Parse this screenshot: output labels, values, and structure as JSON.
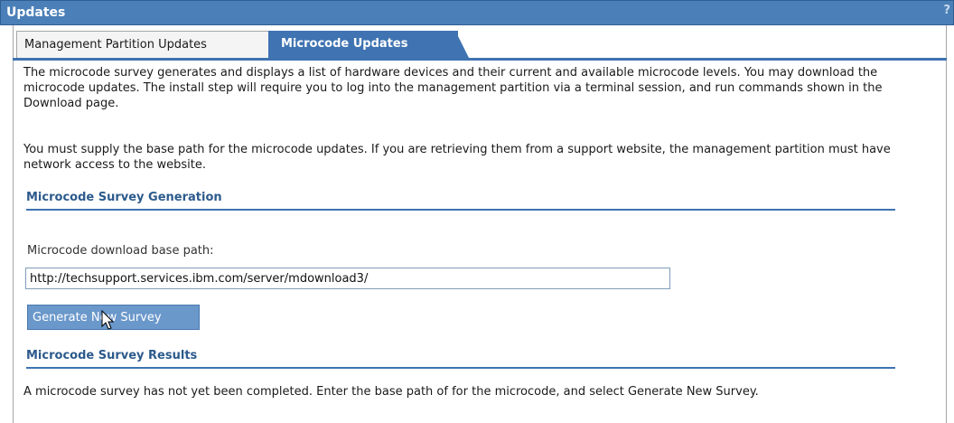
{
  "panel": {
    "title": "Updates",
    "help": "?"
  },
  "tabs": [
    {
      "label": "Management Partition Updates",
      "active": false
    },
    {
      "label": "Microcode Updates",
      "active": true
    }
  ],
  "intro": {
    "paragraph1": "The microcode survey generates and displays a list of hardware devices and their current and available microcode levels. You may download the microcode updates. The install step will require you to log into the management partition via a terminal session, and run commands shown in the Download page.",
    "paragraph2": "You must supply the base path for the microcode updates. If you are retrieving them from a support website, the management partition must have network access to the website."
  },
  "generation": {
    "section_title": "Microcode Survey Generation",
    "path_label": "Microcode download base path:",
    "path_value": "http://techsupport.services.ibm.com/server/mdownload3/",
    "button_label": "Generate New Survey"
  },
  "results": {
    "section_title": "Microcode Survey Results",
    "message": "A microcode survey has not yet been completed. Enter the base path of for the microcode, and select Generate New Survey."
  },
  "colors": {
    "title_bar": "#4a7fb8",
    "active_tab": "#3f73b1",
    "section_title": "#2c5a8c",
    "button": "#6b98cb"
  }
}
